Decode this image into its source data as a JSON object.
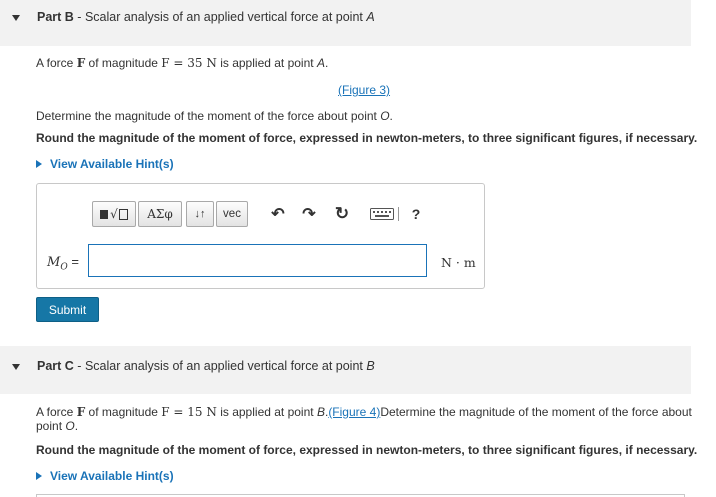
{
  "partB": {
    "prefix": "Part B",
    "dash": " - ",
    "title": "Scalar analysis of an applied vertical force at point ",
    "point": "A",
    "statement_pre": "A force ",
    "statement_F": "F",
    "statement_mid": " of magnitude ",
    "statement_math": "F = 35 N",
    "statement_post": " is applied at point ",
    "statement_point": "A",
    "statement_end": ".",
    "figure_link": "(Figure 3)",
    "question_pre": "Determine the magnitude of the moment of the force about point ",
    "question_point": "O",
    "question_end": ".",
    "instruction": "Round the magnitude of the moment of force, expressed in newton-meters, to three significant figures, if necessary.",
    "hint_label": "View Available Hint(s)",
    "toolbar": {
      "templates_label": "▪√",
      "symbols_label": "ΑΣφ",
      "arrows_label": "↓↑",
      "vec_label": "vec",
      "undo_glyph": "↶",
      "redo_glyph": "↷",
      "reset_glyph": "↻",
      "help_label": "?"
    },
    "answer_label": "Mo =",
    "answer_label_main": "M",
    "answer_label_sub": "O",
    "answer_label_eq": " =",
    "answer_value": "",
    "units": "N · m",
    "submit_label": "Submit"
  },
  "partC": {
    "prefix": "Part C",
    "dash": " - ",
    "title": "Scalar analysis of an applied vertical force at point ",
    "point": "B",
    "statement_pre": "A force ",
    "statement_F": "F",
    "statement_mid": " of magnitude ",
    "statement_math": "F = 15 N",
    "statement_post": " is applied at point ",
    "statement_point": "B",
    "statement_end": ".",
    "figure_link": "(Figure 4)",
    "question_pre": "Determine the magnitude of the moment of the force about",
    "question_line2": "point ",
    "question_point": "O",
    "question_end": ".",
    "instruction": "Round the magnitude of the moment of force, expressed in newton-meters, to three significant figures, if necessary.",
    "hint_label": "View Available Hint(s)"
  }
}
